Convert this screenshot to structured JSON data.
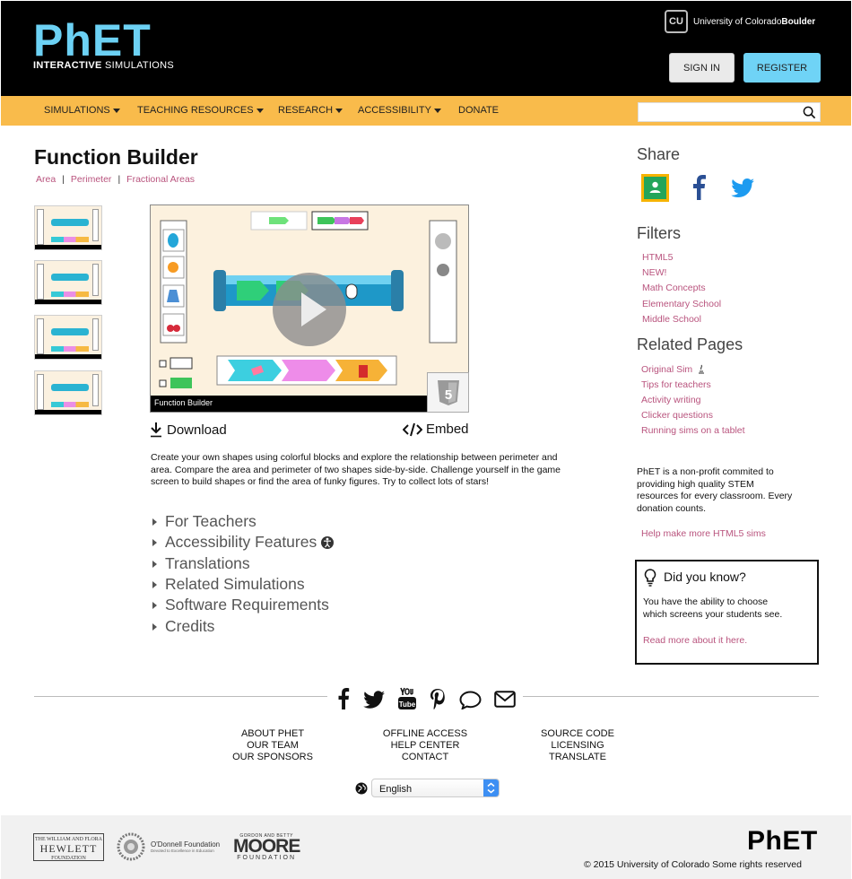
{
  "header": {
    "logo_main_ph": "Ph",
    "logo_main_et": "ET",
    "logo_sub_bold": "INTERACTIVE",
    "logo_sub_rest": " SIMULATIONS",
    "university_prefix": "University of Colorado ",
    "university_bold": "Boulder",
    "cu_mark": "CU",
    "signin_label": "SIGN IN",
    "register_label": "REGISTER"
  },
  "nav": {
    "items": [
      "SIMULATIONS",
      "TEACHING RESOURCES",
      "RESEARCH",
      "ACCESSIBILITY",
      "DONATE"
    ],
    "search_placeholder": ""
  },
  "sim": {
    "title": "Function Builder",
    "breadcrumbs": [
      "Area",
      "Perimeter",
      "Fractional Areas"
    ],
    "preview_name": "Function Builder",
    "html5_badge": "5",
    "download_label": "Download",
    "embed_label": "Embed",
    "description": "Create your own shapes using colorful blocks and explore the relationship between perimeter and area. Compare the area and perimeter of two shapes side-by-side. Challenge yourself in the game screen to build shapes or find the area of funky figures. Try to collect lots of stars!",
    "sections": [
      "For Teachers",
      "Accessibility Features",
      "Translations",
      "Related Simulations",
      "Software Requirements",
      "Credits"
    ]
  },
  "sidebar": {
    "share_heading": "Share",
    "filters_heading": "Filters",
    "filters": [
      "HTML5",
      "NEW!",
      "Math Concepts",
      "Elementary School",
      "Middle School"
    ],
    "related_heading": "Related Pages",
    "related": [
      "Original Sim",
      "Tips for teachers",
      "Activity writing",
      "Clicker questions",
      "Running sims on a tablet"
    ],
    "nonprofit_text": "PhET is a non-profit commited to providing high quality STEM resources for every classroom. Every donation counts.",
    "help_link": "Help make more HTML5 sims",
    "dyk_title": "Did you know?",
    "dyk_body": "You have the ability to choose which screens your students see.",
    "dyk_link": "Read more about it here."
  },
  "footer": {
    "col1": [
      "ABOUT PHET",
      "OUR TEAM",
      "OUR SPONSORS"
    ],
    "col2": [
      "OFFLINE ACCESS",
      "HELP CENTER",
      "CONTACT"
    ],
    "col3": [
      "SOURCE CODE",
      "LICENSING",
      "TRANSLATE"
    ],
    "language": "English",
    "hewlett_top": "THE WILLIAM AND FLORA",
    "hewlett_name": "HEWLETT",
    "hewlett_bottom": "FOUNDATION",
    "odonnell_name": "O'Donnell Foundation",
    "odonnell_tag": "Devoted to Excellence in Education",
    "moore_top": "GORDON AND BETTY",
    "moore_name": "MOORE",
    "moore_bottom": "FOUNDATION",
    "phet_logo_ph": "Ph",
    "phet_logo_et": "ET",
    "copyright": "© 2015 University of Colorado  Some rights reserved"
  },
  "colors": {
    "header_bg": "#000000",
    "nav_bg": "#f9bb4b",
    "register_bg": "#6fd3f6",
    "link_pink": "#b9547e",
    "logo_blue": "#6cd1f4",
    "logo_yellow": "#f6e84a"
  }
}
